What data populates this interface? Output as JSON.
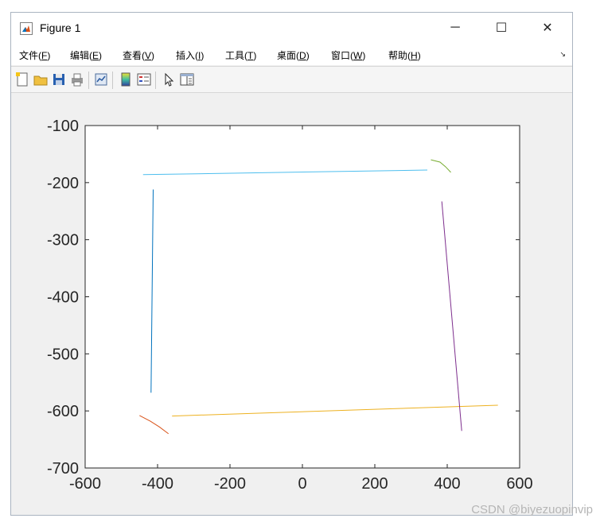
{
  "window": {
    "title": "Figure 1",
    "controls": {
      "minimize": "─",
      "maximize": "☐",
      "close": "✕"
    }
  },
  "menu": {
    "items": [
      {
        "label": "文件",
        "key": "(F)",
        "acc": "F"
      },
      {
        "label": "编辑",
        "key": "(E)",
        "acc": "E"
      },
      {
        "label": "查看",
        "key": "(V)",
        "acc": "V"
      },
      {
        "label": "插入",
        "key": "(I)",
        "acc": "I"
      },
      {
        "label": "工具",
        "key": "(T)",
        "acc": "T"
      },
      {
        "label": "桌面",
        "key": "(D)",
        "acc": "D"
      },
      {
        "label": "窗口",
        "key": "(W)",
        "acc": "W"
      },
      {
        "label": "帮助",
        "key": "(H)",
        "acc": "H"
      }
    ],
    "overflow_icon": "dock-arrow-icon"
  },
  "toolbar": {
    "icons": [
      "new-figure-icon",
      "open-file-icon",
      "save-icon",
      "print-icon",
      "link-plot-icon",
      "insert-colorbar-icon",
      "insert-legend-icon",
      "pointer-icon",
      "property-inspector-icon"
    ]
  },
  "chart_data": {
    "type": "line",
    "xlim": [
      -600,
      600
    ],
    "ylim": [
      -700,
      -100
    ],
    "xticks": [
      -600,
      -400,
      -200,
      0,
      200,
      400,
      600
    ],
    "yticks": [
      -100,
      -200,
      -300,
      -400,
      -500,
      -600,
      -700
    ],
    "grid": false,
    "series": [
      {
        "color": "#0072bd",
        "points": [
          [
            -412,
            -212
          ],
          [
            -418,
            -568
          ]
        ]
      },
      {
        "color": "#d95319",
        "points": [
          [
            -450,
            -608
          ],
          [
            -420,
            -618
          ],
          [
            -395,
            -628
          ],
          [
            -370,
            -640
          ]
        ]
      },
      {
        "color": "#edb120",
        "points": [
          [
            -360,
            -609
          ],
          [
            540,
            -590
          ]
        ]
      },
      {
        "color": "#7e2f8e",
        "points": [
          [
            385,
            -233
          ],
          [
            440,
            -635
          ]
        ]
      },
      {
        "color": "#77ac30",
        "points": [
          [
            355,
            -160
          ],
          [
            380,
            -164
          ],
          [
            395,
            -172
          ],
          [
            410,
            -182
          ]
        ]
      },
      {
        "color": "#4dbeee",
        "points": [
          [
            -440,
            -186
          ],
          [
            345,
            -178
          ]
        ]
      }
    ]
  },
  "watermark": "CSDN @biyezuopinvip"
}
